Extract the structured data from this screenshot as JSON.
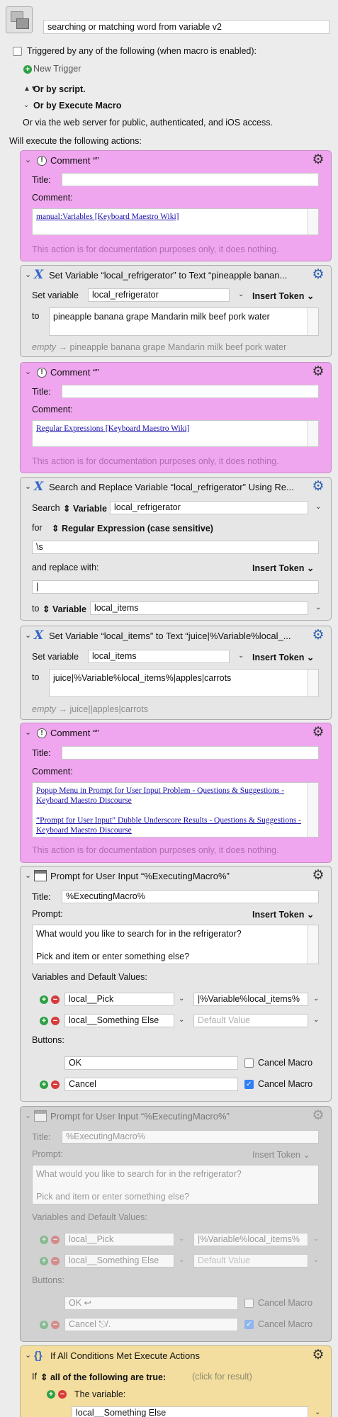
{
  "macro": {
    "name": "searching or matching word from variable v2"
  },
  "triggers": {
    "label": "Triggered by any of the following (when macro is enabled):",
    "new_trigger": "New Trigger",
    "or_script": "Or by script.",
    "or_execute": "Or by Execute Macro",
    "web": "Or via the web server for public, authenticated, and iOS access.",
    "will_execute": "Will execute the following actions:"
  },
  "a1": {
    "title": "Comment “”",
    "title_label": "Title:",
    "title_value": "",
    "comment_label": "Comment:",
    "link": "manual:Variables [Keyboard Maestro Wiki]",
    "footer": "This action is for documentation purposes only, it does nothing."
  },
  "a2": {
    "title": "Set Variable “local_refrigerator” to Text “pineapple banan...",
    "set_label": "Set variable",
    "var": "local_refrigerator",
    "insert_token": "Insert Token",
    "to_label": "to",
    "text": "pineapple banana grape Mandarin milk beef pork water",
    "empty_word": "empty",
    "result": "pineapple banana grape Mandarin milk beef pork water"
  },
  "a3": {
    "title": "Comment “”",
    "title_label": "Title:",
    "title_value": "",
    "comment_label": "Comment:",
    "link": "Regular Expressions [Keyboard Maestro Wiki]",
    "footer": "This action is for documentation purposes only, it does nothing."
  },
  "a4": {
    "title": "Search and Replace Variable “local_refrigerator” Using Re...",
    "search_label": "Search",
    "search_type": "Variable",
    "var": "local_refrigerator",
    "for_label": "for",
    "for_type": "Regular Expression (case sensitive)",
    "pattern": "\\s",
    "replace_label": "and replace with:",
    "insert_token": "Insert Token",
    "replace_value": "|",
    "to_label": "to",
    "to_type": "Variable",
    "to_var": "local_items"
  },
  "a5": {
    "title": "Set Variable “local_items” to Text “juice|%Variable%local_...",
    "set_label": "Set variable",
    "var": "local_items",
    "insert_token": "Insert Token",
    "to_label": "to",
    "text": "juice|%Variable%local_items%|apples|carrots",
    "empty_word": "empty",
    "result": "juice||apples|carrots"
  },
  "a6": {
    "title": "Comment “”",
    "title_label": "Title:",
    "title_value": "",
    "comment_label": "Comment:",
    "link1": "Popup Menu in Prompt for User Input Problem - Questions & Suggestions - Keyboard Maestro Discourse",
    "link2": "“Prompt for User Input” Dubble Underscore Results - Questions & Suggestions - Keyboard Maestro Discourse",
    "footer": "This action is for documentation purposes only, it does nothing."
  },
  "a7": {
    "title": "Prompt for User Input “%ExecutingMacro%”",
    "title_label": "Title:",
    "title_value": "%ExecutingMacro%",
    "prompt_label": "Prompt:",
    "insert_token": "Insert Token",
    "prompt_line1": "What would you like to search for in the refrigerator?",
    "prompt_line2": "Pick and item or enter something else?",
    "vars_label": "Variables and Default Values:",
    "var1": "local__Pick",
    "def1": "|%Variable%local_items%",
    "var2": "local__Something Else",
    "def2_placeholder": "Default Value",
    "buttons_label": "Buttons:",
    "btn1": "OK",
    "btn2": "Cancel",
    "cancel_macro": "Cancel Macro",
    "btn1_cancel_macro_checked": false,
    "btn2_cancel_macro_checked": true
  },
  "a8": {
    "title": "Prompt for User Input “%ExecutingMacro%”",
    "title_label": "Title:",
    "title_value": "%ExecutingMacro%",
    "prompt_label": "Prompt:",
    "insert_token": "Insert Token",
    "prompt_line1": "What would you like to search for in the refrigerator?",
    "prompt_line2": "Pick and item or enter something else?",
    "vars_label": "Variables and Default Values:",
    "var1": "local__Pick",
    "def1": "|%Variable%local_items%",
    "var2": "local__Something Else",
    "def2_placeholder": "Default Value",
    "buttons_label": "Buttons:",
    "btn1": "OK ↩",
    "btn2": "Cancel ⎋/.",
    "cancel_macro": "Cancel Macro"
  },
  "a9": {
    "title": "If All Conditions Met Execute Actions",
    "if_label": "If",
    "cond_type": "all of the following are true:",
    "click_hint": "(click for result)",
    "the_variable": "The variable:",
    "var": "local__Something Else"
  }
}
